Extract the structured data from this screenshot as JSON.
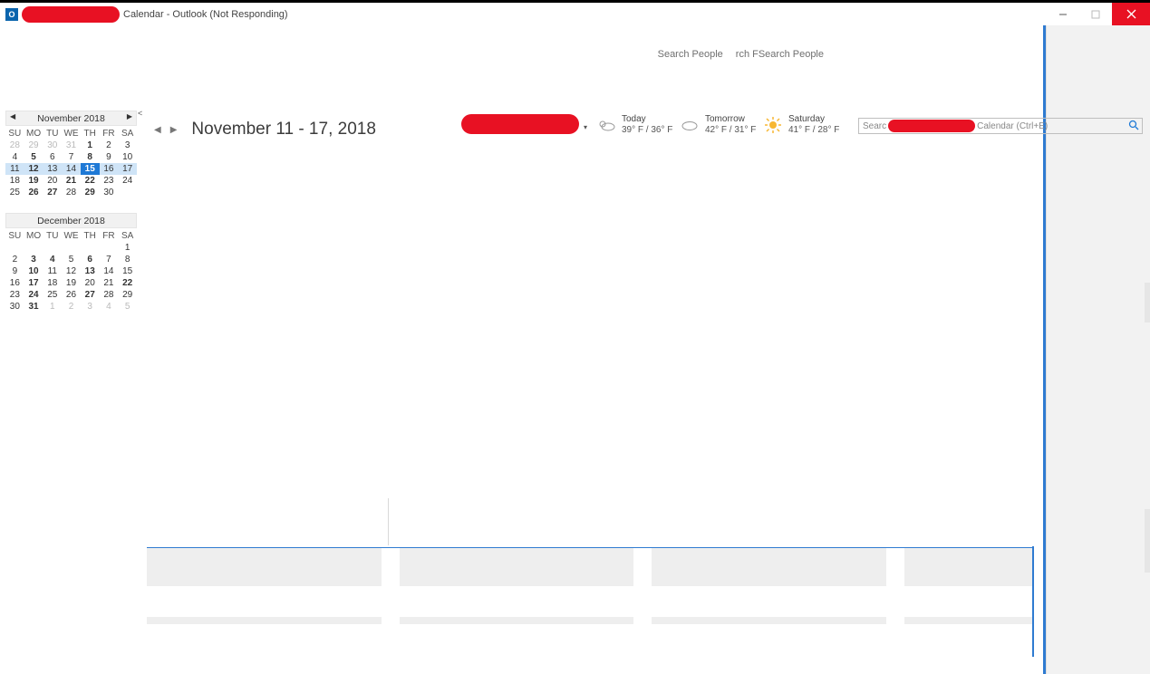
{
  "title_suffix": "Calendar - Outlook (Not Responding)",
  "outlook_o": "O",
  "search_people": "Search People",
  "search_people2": "rch FSearch People",
  "collapse_glyph": "<",
  "nav_prev": "◀",
  "nav_next": "▶",
  "date_range": "November 11 - 17, 2018",
  "dropdown_caret": "▾",
  "weather": [
    {
      "label": "Today",
      "temp": "39° F / 36° F"
    },
    {
      "label": "Tomorrow",
      "temp": "42° F / 31° F"
    },
    {
      "label": "Saturday",
      "temp": "41° F / 28° F"
    }
  ],
  "search_prefix": "Searc",
  "search_placeholder": "Calendar (Ctrl+E)",
  "dow": [
    "SU",
    "MO",
    "TU",
    "WE",
    "TH",
    "FR",
    "SA"
  ],
  "month1": {
    "title": "November 2018",
    "prev": "◀",
    "next": "▶",
    "rows": [
      [
        {
          "d": "28",
          "g": 1
        },
        {
          "d": "29",
          "g": 1
        },
        {
          "d": "30",
          "g": 1
        },
        {
          "d": "31",
          "g": 1
        },
        {
          "d": "1",
          "b": 1
        },
        {
          "d": "2"
        },
        {
          "d": "3"
        }
      ],
      [
        {
          "d": "4"
        },
        {
          "d": "5",
          "b": 1
        },
        {
          "d": "6"
        },
        {
          "d": "7"
        },
        {
          "d": "8",
          "b": 1
        },
        {
          "d": "9"
        },
        {
          "d": "10"
        }
      ],
      [
        {
          "d": "11"
        },
        {
          "d": "12",
          "b": 1
        },
        {
          "d": "13"
        },
        {
          "d": "14"
        },
        {
          "d": "15",
          "today": 1
        },
        {
          "d": "16"
        },
        {
          "d": "17"
        }
      ],
      [
        {
          "d": "18"
        },
        {
          "d": "19",
          "b": 1
        },
        {
          "d": "20"
        },
        {
          "d": "21",
          "b": 1
        },
        {
          "d": "22",
          "b": 1
        },
        {
          "d": "23"
        },
        {
          "d": "24"
        }
      ],
      [
        {
          "d": "25"
        },
        {
          "d": "26",
          "b": 1
        },
        {
          "d": "27",
          "b": 1
        },
        {
          "d": "28"
        },
        {
          "d": "29",
          "b": 1
        },
        {
          "d": "30"
        },
        {
          "d": ""
        }
      ]
    ],
    "selected_row_index": 2
  },
  "month2": {
    "title": "December 2018",
    "rows": [
      [
        {
          "d": ""
        },
        {
          "d": ""
        },
        {
          "d": ""
        },
        {
          "d": ""
        },
        {
          "d": ""
        },
        {
          "d": ""
        },
        {
          "d": "1"
        }
      ],
      [
        {
          "d": "2"
        },
        {
          "d": "3",
          "b": 1
        },
        {
          "d": "4",
          "b": 1
        },
        {
          "d": "5"
        },
        {
          "d": "6",
          "b": 1
        },
        {
          "d": "7"
        },
        {
          "d": "8"
        }
      ],
      [
        {
          "d": "9"
        },
        {
          "d": "10",
          "b": 1
        },
        {
          "d": "11"
        },
        {
          "d": "12"
        },
        {
          "d": "13",
          "b": 1
        },
        {
          "d": "14"
        },
        {
          "d": "15"
        }
      ],
      [
        {
          "d": "16"
        },
        {
          "d": "17",
          "b": 1
        },
        {
          "d": "18"
        },
        {
          "d": "19"
        },
        {
          "d": "20"
        },
        {
          "d": "21"
        },
        {
          "d": "22",
          "b": 1
        }
      ],
      [
        {
          "d": "23"
        },
        {
          "d": "24",
          "b": 1
        },
        {
          "d": "25"
        },
        {
          "d": "26"
        },
        {
          "d": "27",
          "b": 1
        },
        {
          "d": "28"
        },
        {
          "d": "29"
        }
      ],
      [
        {
          "d": "30"
        },
        {
          "d": "31",
          "b": 1
        },
        {
          "d": "1",
          "g": 1
        },
        {
          "d": "2",
          "g": 1
        },
        {
          "d": "3",
          "g": 1
        },
        {
          "d": "4",
          "g": 1
        },
        {
          "d": "5",
          "g": 1
        }
      ]
    ]
  }
}
